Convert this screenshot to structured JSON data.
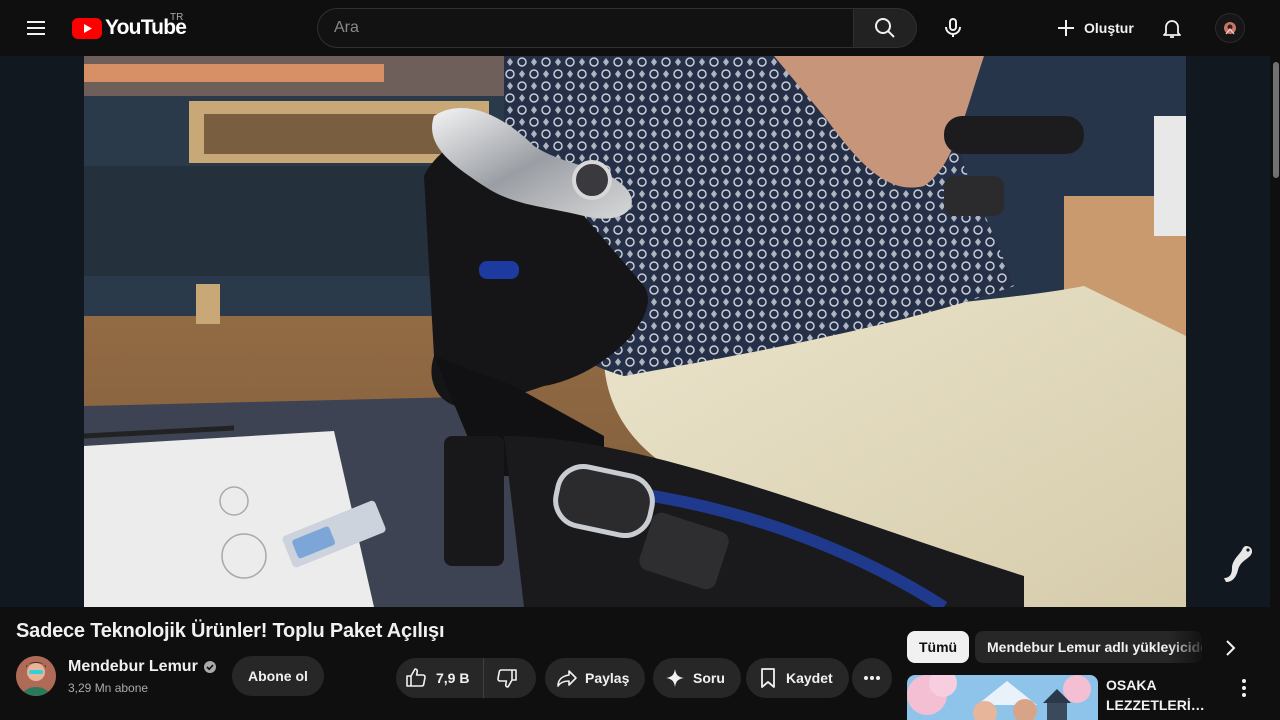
{
  "header": {
    "logo_text": "YouTube",
    "country_code": "TR",
    "search_placeholder": "Ara",
    "create_label": "Oluştur"
  },
  "video": {
    "title": "Sadece Teknolojik Ürünler! Toplu Paket Açılışı"
  },
  "channel": {
    "name": "Mendebur Lemur",
    "verified": true,
    "subscribers": "3,29 Mn abone",
    "subscribe_label": "Abone ol"
  },
  "actions": {
    "likes": "7,9 B",
    "share_label": "Paylaş",
    "ask_label": "Soru",
    "save_label": "Kaydet"
  },
  "sidebar": {
    "chips": [
      {
        "label": "Tümü",
        "selected": true
      },
      {
        "label": "Mendebur Lemur adlı yükleyiciden",
        "selected": false
      }
    ],
    "recommendations": [
      {
        "title_line1": "OSAKA",
        "title_line2": "LEZZETLERİ ..."
      }
    ]
  },
  "colors": {
    "background": "#0f0f0f",
    "brand_red": "#ff0000",
    "pill_bg": "#272727",
    "text_secondary": "#aaaaaa"
  },
  "icons": [
    "menu-icon",
    "youtube-logo-icon",
    "search-icon",
    "mic-icon",
    "plus-icon",
    "bell-icon",
    "like-icon",
    "dislike-icon",
    "share-icon",
    "sparkle-icon",
    "bookmark-icon",
    "more-horizontal-icon",
    "chevron-right-icon",
    "more-vertical-icon",
    "verified-badge-icon"
  ]
}
